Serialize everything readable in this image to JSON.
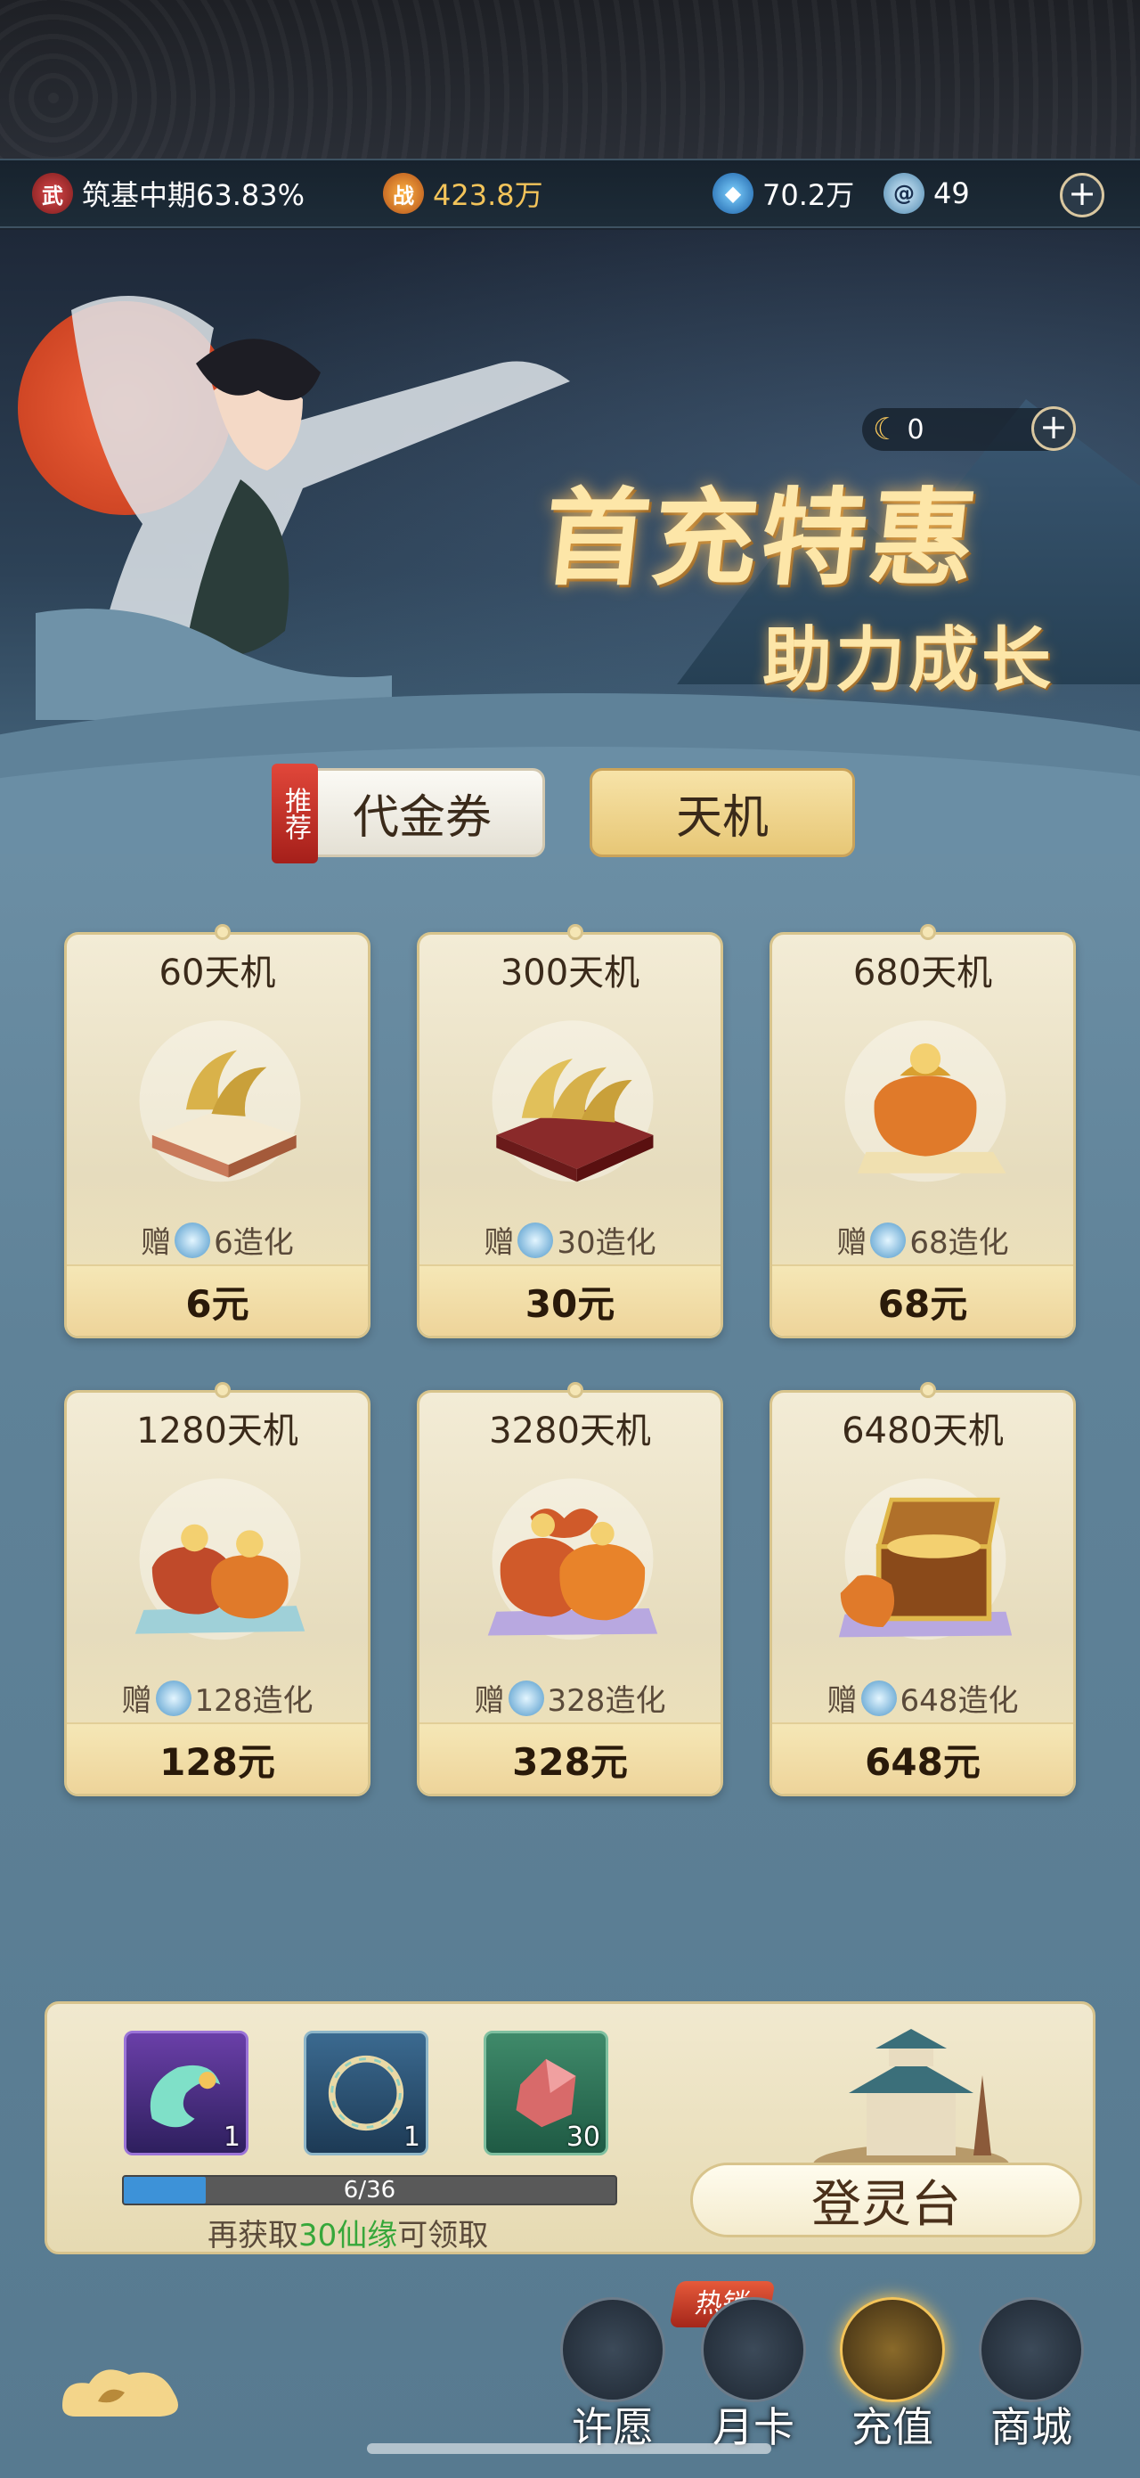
{
  "status_bar": {
    "realm_label": "筑基中期63.83%",
    "power_value": "423.8万",
    "gem_value": "70.2万",
    "swirl_value": "49"
  },
  "hero": {
    "currency_value": "0",
    "title": "首充特惠",
    "subtitle": "助力成长"
  },
  "tabs": {
    "recommend_badge": "推荐",
    "voucher_label": "代金券",
    "tianji_label": "天机"
  },
  "products": [
    {
      "title": "60天机",
      "bonus_prefix": "赠",
      "bonus": "6造化",
      "price": "6元",
      "art": "small-jade-icon"
    },
    {
      "title": "300天机",
      "bonus_prefix": "赠",
      "bonus": "30造化",
      "price": "30元",
      "art": "jade-stack-icon"
    },
    {
      "title": "680天机",
      "bonus_prefix": "赠",
      "bonus": "68造化",
      "price": "68元",
      "art": "money-bag-icon"
    },
    {
      "title": "1280天机",
      "bonus_prefix": "赠",
      "bonus": "128造化",
      "price": "128元",
      "art": "money-bags-icon"
    },
    {
      "title": "3280天机",
      "bonus_prefix": "赠",
      "bonus": "328造化",
      "price": "328元",
      "art": "money-bags-large-icon"
    },
    {
      "title": "6480天机",
      "bonus_prefix": "赠",
      "bonus": "648造化",
      "price": "648元",
      "art": "treasure-chest-icon"
    }
  ],
  "reward_panel": {
    "rewards": [
      {
        "count": "1",
        "icon": "spirit-scroll-icon"
      },
      {
        "count": "1",
        "icon": "jade-ring-icon"
      },
      {
        "count": "30",
        "icon": "red-ore-icon"
      }
    ],
    "progress_text": "6/36",
    "progress": 0.1667,
    "hint_prefix": "再获取",
    "hint_highlight": "30仙缘",
    "hint_suffix": "可领取",
    "action_label": "登灵台"
  },
  "nav": {
    "hot_badge": "热销",
    "items": [
      {
        "label": "许愿",
        "icon": "wish-icon"
      },
      {
        "label": "月卡",
        "icon": "month-card-icon"
      },
      {
        "label": "充值",
        "icon": "recharge-icon"
      },
      {
        "label": "商城",
        "icon": "shop-icon"
      }
    ]
  },
  "colors": {
    "accent_gold": "#f3c45a",
    "progress_blue": "#3d92d8",
    "highlight_green": "#36a73a",
    "badge_red": "#d23a2a"
  }
}
